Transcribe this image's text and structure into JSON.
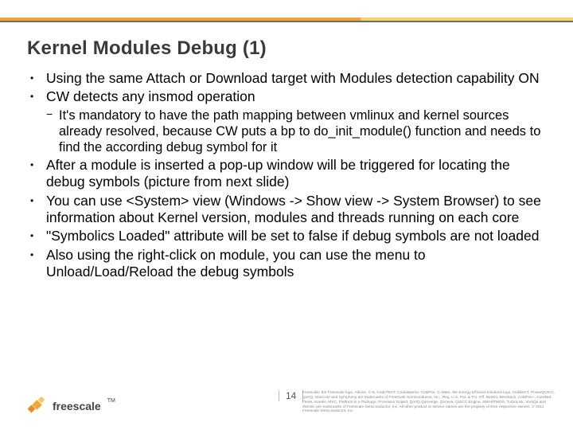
{
  "title": "Kernel Modules Debug (1)",
  "bullets": [
    {
      "level": 1,
      "text": "Using the same Attach or Download target with Modules detection capability ON"
    },
    {
      "level": 1,
      "text": "CW detects any insmod operation"
    },
    {
      "level": 2,
      "text": "It's mandatory to have the path mapping between vmlinux and kernel sources already resolved, because CW puts a bp to do_init_module() function and needs to find the according debug symbol for it"
    },
    {
      "level": 1,
      "text": "After a module is inserted a pop-up window will be triggered for locating the debug symbols (picture from next slide)"
    },
    {
      "level": 1,
      "text": "You can use <System> view (Windows -> Show view -> System Browser) to see information about Kernel version, modules and threads running on each core"
    },
    {
      "level": 1,
      "text": "\"Symbolics Loaded\" attribute will be set to false if debug symbols are not loaded"
    },
    {
      "level": 1,
      "text": "Also using the right-click on module, you can use the menu to Unload/Load/Reload the debug symbols"
    }
  ],
  "brand": "freescale",
  "page_number": "14",
  "legal": "Freescale, the Freescale logo, AltiVec, C-5, CodeTEST, CodeWarrior, ColdFire, C-Ware, the Energy Efficient Solutions logo, mobileGT, PowerQUICC, QorIQ, StarCore and Symphony are trademarks of Freescale Semiconductor, Inc., Reg. U.S. Pat. & Tm. Off. BeeKit, BeeStack, ColdFire+, CoreNet, Flexis, Kinetis, MXC, Platform in a Package, Processor Expert, QorIQ Qonverge, Qorivva, QUICC Engine, SMARTMOS, TurboLink, VortiQa and Xtrinsic are trademarks of Freescale Semiconductor, Inc. All other product or service names are the property of their respective owners. © 2011 Freescale Semiconductor, Inc."
}
